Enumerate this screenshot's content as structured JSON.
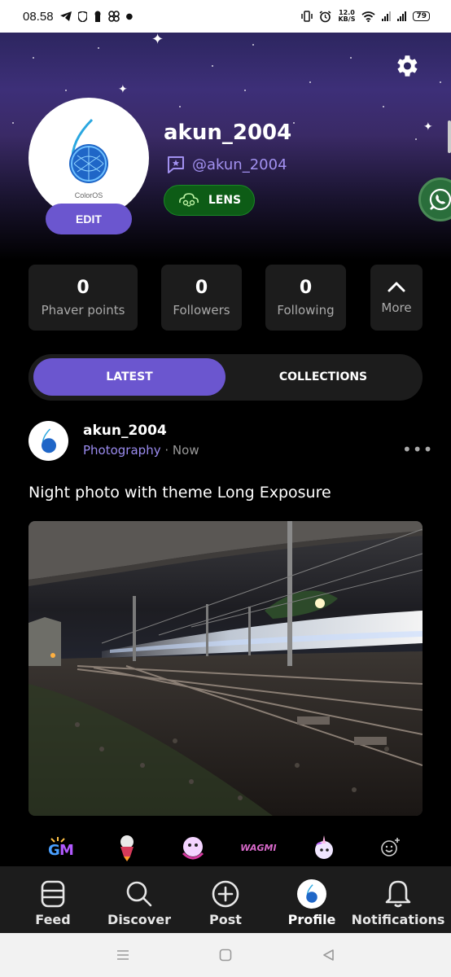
{
  "status_bar": {
    "time": "08.58",
    "net_speed_value": "12.0",
    "net_speed_unit": "KB/S",
    "battery": "79",
    "icons": [
      "telegram-icon",
      "shield-icon",
      "keyhole-icon",
      "pinwheel-icon",
      "dot-icon",
      "vibrate-icon",
      "alarm-icon",
      "wifi-icon",
      "signal-icon",
      "signal-icon"
    ]
  },
  "profile": {
    "username": "akun_2004",
    "handle": "@akun_2004",
    "edit_label": "EDIT",
    "lens_label": "LENS",
    "avatar_text": "ColorOS"
  },
  "stats": [
    {
      "value": "0",
      "label": "Phaver points"
    },
    {
      "value": "0",
      "label": "Followers"
    },
    {
      "value": "0",
      "label": "Following"
    }
  ],
  "more_label": "More",
  "tabs": {
    "latest": "LATEST",
    "collections": "COLLECTIONS"
  },
  "post": {
    "username": "akun_2004",
    "category": "Photography",
    "separator": "·",
    "time": "Now",
    "more": "•••",
    "title": "Night photo with theme Long Exposure"
  },
  "reactions": {
    "gm": "GM",
    "wagmi": "WAGMI"
  },
  "nav": {
    "feed": "Feed",
    "discover": "Discover",
    "post": "Post",
    "profile": "Profile",
    "notifications": "Notifications"
  },
  "colors": {
    "accent": "#6b56cf",
    "handle": "#a291f0",
    "lens_green": "#0d5c16",
    "card": "#1c1c1c"
  }
}
